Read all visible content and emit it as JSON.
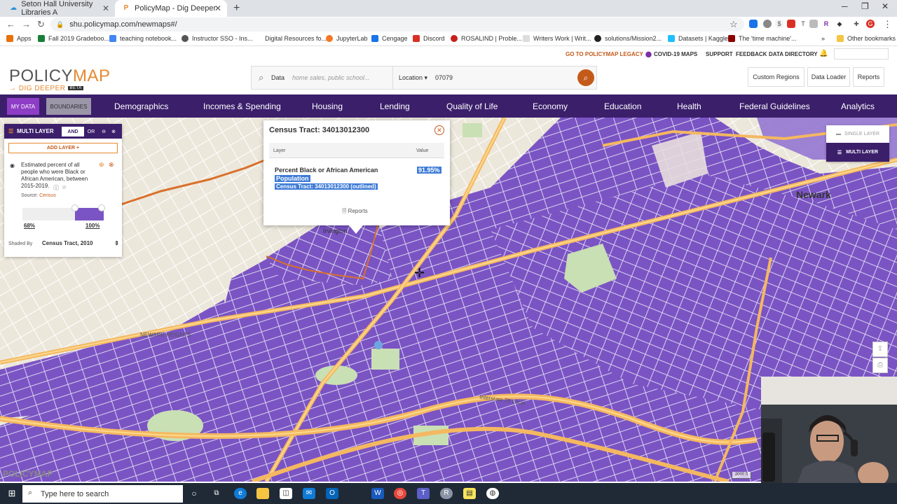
{
  "browser": {
    "tabs": [
      {
        "title": "Seton Hall University Libraries A",
        "active": false
      },
      {
        "title": "PolicyMap - Dig Deeper",
        "active": true
      }
    ],
    "url": "shu.policymap.com/newmaps#/",
    "bookmarks": [
      "Apps",
      "Fall 2019 Gradeboo...",
      "teaching notebook...",
      "Instructor SSO - Ins...",
      "Digital Resources fo...",
      "JupyterLab",
      "Cengage",
      "Discord",
      "ROSALIND | Proble...",
      "Writers Work | Writ...",
      "solutions/Mission2...",
      "Datasets | Kaggle",
      "The 'time machine'..."
    ],
    "other_bookmarks": "Other bookmarks",
    "bookmarks_more": "»"
  },
  "util_bar": {
    "legacy": "GO TO POLICYMAP LEGACY",
    "covid": "COVID-19 MAPS",
    "support": "SUPPORT",
    "feedback": "FEEDBACK",
    "directory": "DATA DIRECTORY"
  },
  "header": {
    "logo_policy": "POLICY",
    "logo_map": "MAP",
    "logo_tag": "DIG DEEPER",
    "logo_beta": "BETA",
    "search_data_label": "Data",
    "search_placeholder": "home sales, public school...",
    "location_label": "Location ▾",
    "location_value": "07079",
    "custom_regions": "Custom Regions",
    "data_loader": "Data Loader",
    "reports": "Reports"
  },
  "nav": {
    "my_data": "MY DATA",
    "boundaries": "BOUNDARIES",
    "items": [
      "Demographics",
      "Incomes & Spending",
      "Housing",
      "Lending",
      "Quality of Life",
      "Economy",
      "Education",
      "Health",
      "Federal Guidelines",
      "Analytics"
    ]
  },
  "panel": {
    "title": "MULTI LAYER",
    "and": "AND",
    "or": "OR",
    "add_layer": "ADD LAYER +",
    "layer_desc": "Estimated percent of all people who were Black or African American, between 2015-2019.",
    "source_label": "Source:",
    "source_value": "Census",
    "range_min": "68%",
    "range_max": "100%",
    "range_low_fraction": 0.65,
    "shaded_by_label": "Shaded By",
    "shaded_by_value": "Census Tract, 2010"
  },
  "popup": {
    "title": "Census Tract: 34013012300",
    "col_layer": "Layer",
    "col_value": "Value",
    "row_label_1": "Percent Black or African American",
    "row_label_2": "Population",
    "row_value": "91.95%",
    "row_sub": "Census Tract: 34013012300 (outlined)",
    "reports": "Reports"
  },
  "map": {
    "layer_single": "SINGLE LAYER",
    "layer_multi": "MULTI LAYER",
    "city": "Newark",
    "places": [
      "Irvington",
      "NEWARK HEIGHTS",
      "Interstate 78 Local"
    ],
    "logo": "POLICYMAP",
    "scale": "2000 ft",
    "colors": {
      "tract": "#7b54c4",
      "tract_light": "#8f6fd0",
      "land": "#ece7db",
      "highway": "#f4b860",
      "park": "#c9dfb4"
    }
  },
  "taskbar": {
    "search_placeholder": "Type here to search"
  }
}
